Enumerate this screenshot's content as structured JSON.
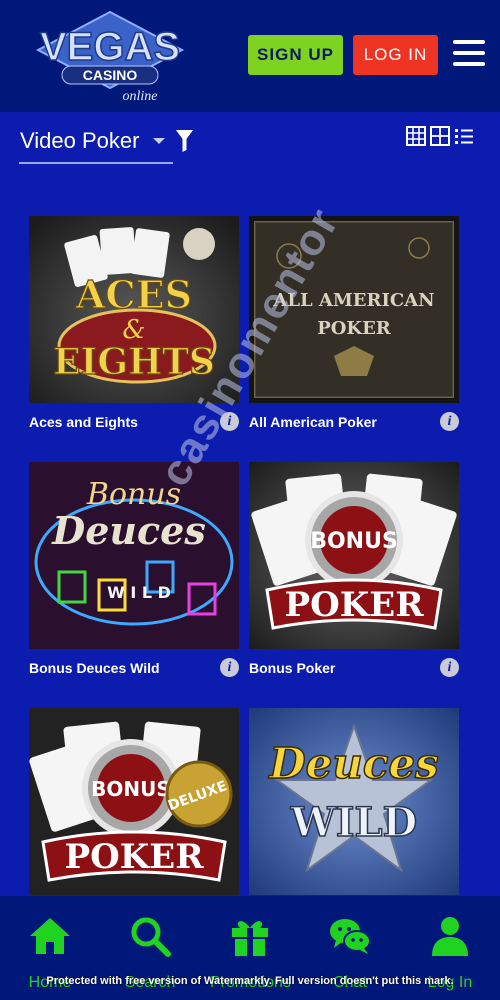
{
  "header": {
    "logo_text": "VEGAS",
    "logo_subtext": "CASINO",
    "logo_script": "online",
    "signup_label": "SIGN UP",
    "login_label": "LOG IN"
  },
  "filter": {
    "category_label": "Video Poker"
  },
  "games": [
    {
      "title": "Aces and Eights",
      "art_line1": "ACES",
      "art_line2": "&",
      "art_line3": "EIGHTS"
    },
    {
      "title": "All American Poker",
      "art_line1": "ALL AMERICAN",
      "art_line2": "POKER"
    },
    {
      "title": "Bonus Deuces Wild",
      "art_line1": "Bonus",
      "art_line2": "Deuces",
      "art_line3": "W I L D"
    },
    {
      "title": "Bonus Poker",
      "art_line1": "BONUS",
      "art_line2": "POKER"
    },
    {
      "title": "",
      "art_line1": "BONUS",
      "art_line2": "POKER",
      "art_line3": "DELUXE"
    },
    {
      "title": "",
      "art_line1": "Deuces",
      "art_line2": "WILD"
    }
  ],
  "watermark_overlay": "casinomentor",
  "bottom_nav": [
    {
      "label": "Home",
      "icon": "home-icon"
    },
    {
      "label": "Search",
      "icon": "search-icon"
    },
    {
      "label": "Promotions",
      "icon": "gift-icon"
    },
    {
      "label": "Chat",
      "icon": "chat-icon"
    },
    {
      "label": "Log In",
      "icon": "user-icon"
    }
  ],
  "watermark_notice": "Protected with free version of Watermarkly. Full version doesn't put this mark.",
  "colors": {
    "page_bg": "#0c1cae",
    "bar_bg": "#00187a",
    "signup": "#7ed321",
    "login": "#ee3524",
    "nav_green": "#21d321"
  }
}
